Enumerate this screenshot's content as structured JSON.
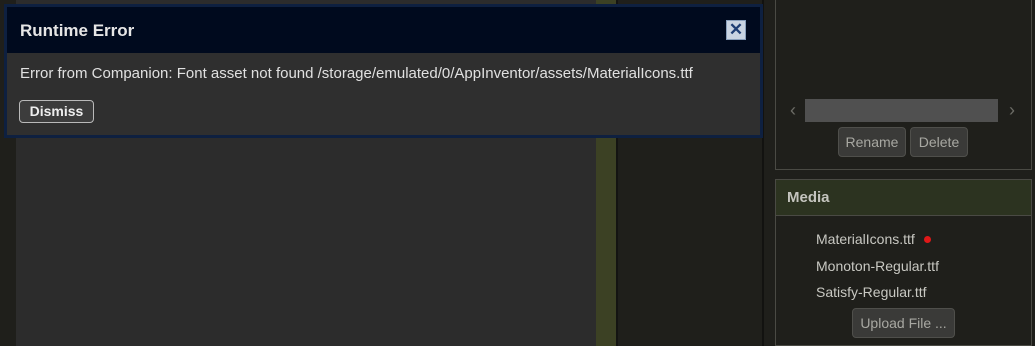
{
  "dialog": {
    "title": "Runtime Error",
    "close_icon": "close-icon",
    "message": "Error from Companion: Font asset not found /storage/emulated/0/AppInventor/assets/MaterialIcons.ttf",
    "dismiss_label": "Dismiss"
  },
  "components": {
    "scroll_left_icon": "chevron-left-icon",
    "scroll_right_icon": "chevron-right-icon",
    "rename_label": "Rename",
    "delete_label": "Delete"
  },
  "media": {
    "title": "Media",
    "items": [
      {
        "name": "MaterialIcons.ttf",
        "flagged": true
      },
      {
        "name": "Monoton-Regular.ttf",
        "flagged": false
      },
      {
        "name": "Satisfy-Regular.ttf",
        "flagged": false
      }
    ],
    "flag_color": "#e01818",
    "upload_label": "Upload File ..."
  },
  "colors": {
    "dialog_title_bg": "#000a1e",
    "dialog_body_bg": "#2f2f2f",
    "media_header_bg": "#2c3320",
    "page_bg": "#1f1f1b"
  }
}
